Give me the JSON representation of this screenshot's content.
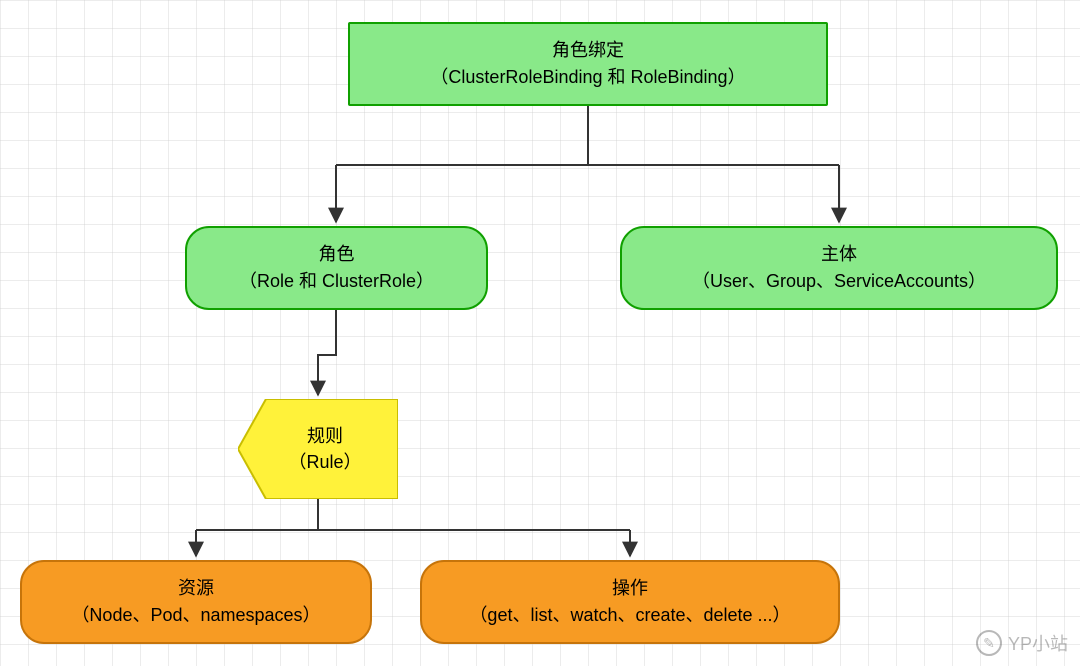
{
  "colors": {
    "green_fill": "#89e989",
    "green_stroke": "#10a000",
    "yellow_fill": "#fff23a",
    "yellow_stroke": "#c9be00",
    "orange_fill": "#f79b23",
    "orange_stroke": "#c6740a",
    "line": "#333333"
  },
  "nodes": {
    "binding": {
      "line1": "角色绑定",
      "line2": "（ClusterRoleBinding 和 RoleBinding）"
    },
    "role": {
      "line1": "角色",
      "line2": "（Role 和 ClusterRole）"
    },
    "subject": {
      "line1": "主体",
      "line2": "（User、Group、ServiceAccounts）"
    },
    "rule": {
      "line1": "规则",
      "line2": "（Rule）"
    },
    "resource": {
      "line1": "资源",
      "line2": "（Node、Pod、namespaces）"
    },
    "action": {
      "line1": "操作",
      "line2": "（get、list、watch、create、delete ...）"
    }
  },
  "watermark": {
    "text": "YP小站",
    "icon_glyph": "✎"
  }
}
